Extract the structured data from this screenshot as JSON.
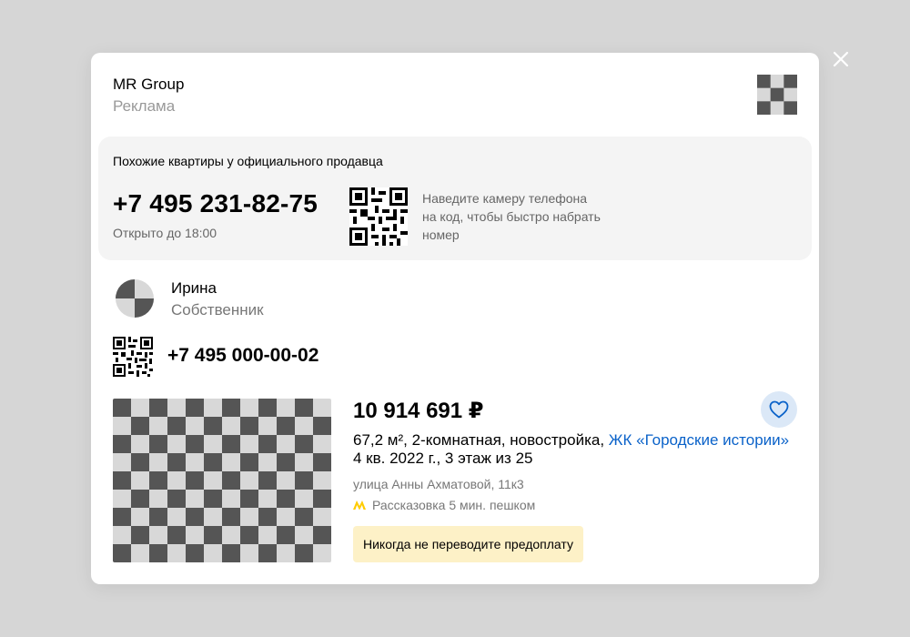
{
  "close": {
    "icon": "close-icon"
  },
  "seller": {
    "name": "MR Group",
    "tag": "Реклама",
    "logo_icon": "seller-logo"
  },
  "offer": {
    "title": "Похожие квартиры у официального продавца",
    "phone": "+7 495 231-82-75",
    "hours": "Открыто до 18:00",
    "qr_icon": "qr-code-icon",
    "hint": "Наведите камеру телефона на код, чтобы быстро набрать номер"
  },
  "agent": {
    "name": "Ирина",
    "role": "Собственник",
    "avatar_icon": "avatar",
    "qr_icon": "qr-code-icon",
    "phone": "+7 495 000-00-02"
  },
  "listing": {
    "price": "10 914 691 ₽",
    "desc": "67,2 м², 2-комнатная, новостройка,",
    "complex_link": "ЖК «Городские истории»",
    "sub": "4 кв. 2022 г., 3 этаж из 25",
    "address": "улица Анны Ахматовой, 11к3",
    "metro": "Рассказовка 5 мин. пешком",
    "metro_color": "#ffcc00",
    "favorite_icon": "heart-icon",
    "warning": "Никогда не переводите предоплату"
  },
  "colors": {
    "link": "#0a62c9",
    "warning_bg": "#fdf1c7",
    "offer_bg": "#f4f4f4",
    "fav_bg": "#dbe8f7"
  }
}
